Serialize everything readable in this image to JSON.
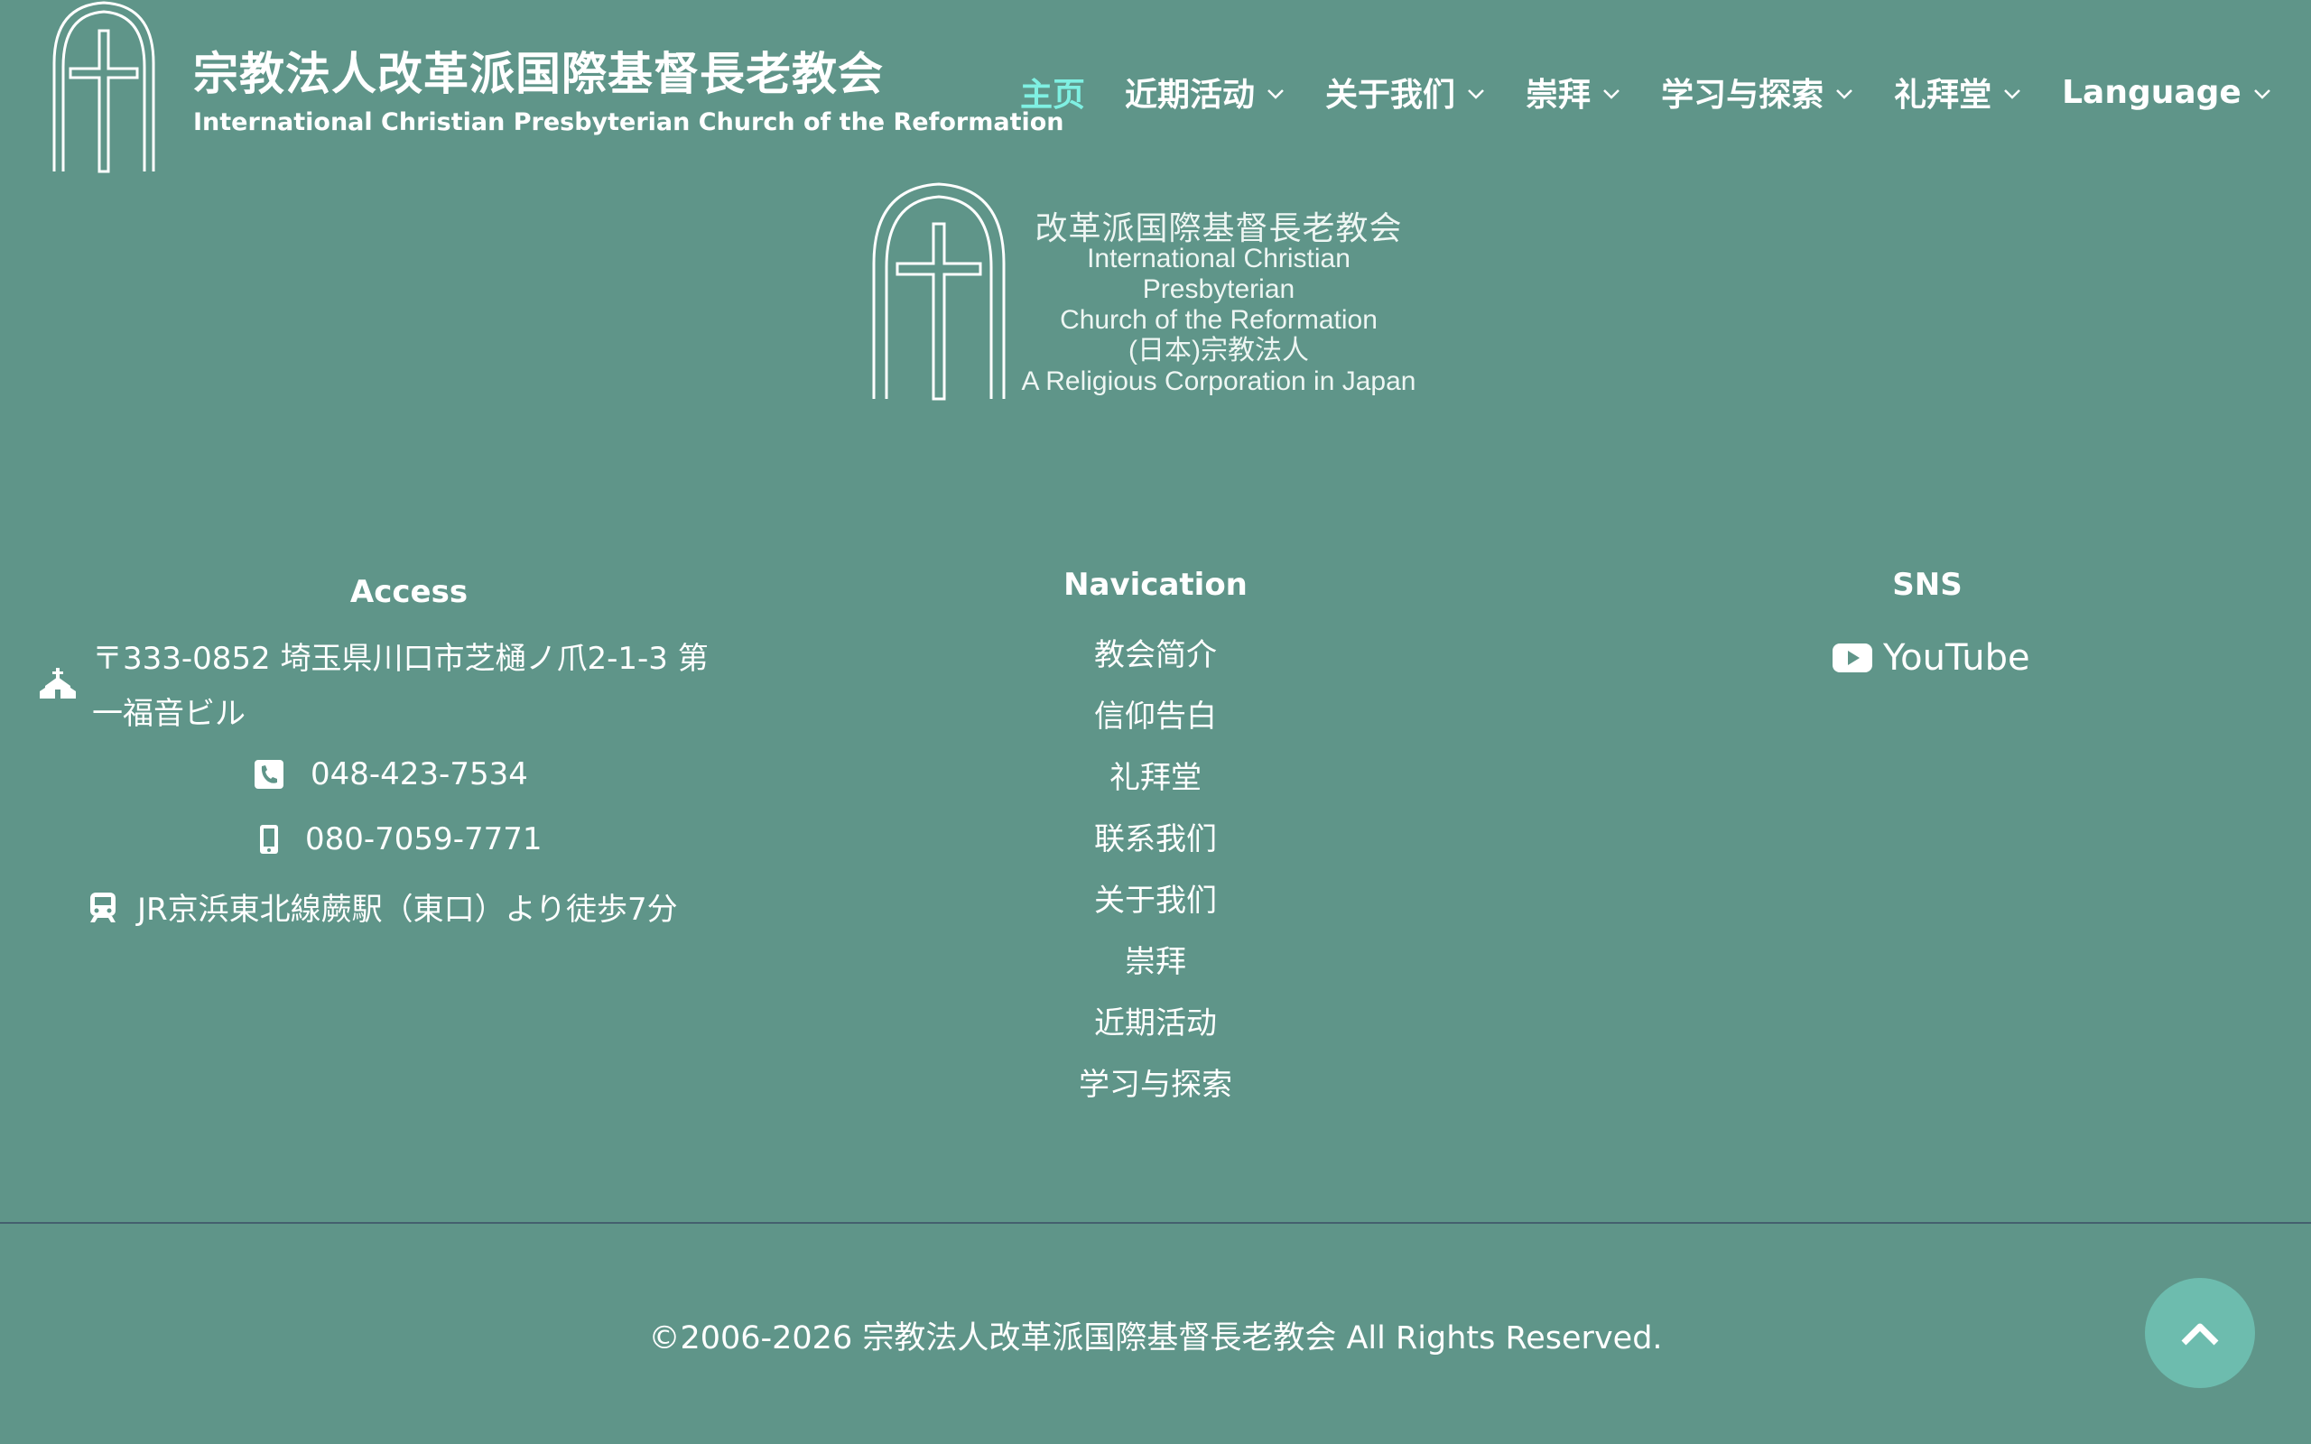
{
  "header": {
    "title": "宗教法人改革派国際基督長老教会",
    "subtitle": "International Christian Presbyterian Church of the Reformation",
    "logo_icon": "church-arch-cross-icon"
  },
  "nav": {
    "items": [
      {
        "label": "主页",
        "active": true,
        "has_dropdown": false
      },
      {
        "label": "近期活动",
        "active": false,
        "has_dropdown": true
      },
      {
        "label": "关于我们",
        "active": false,
        "has_dropdown": true
      },
      {
        "label": "崇拜",
        "active": false,
        "has_dropdown": true
      },
      {
        "label": "学习与探索",
        "active": false,
        "has_dropdown": true
      },
      {
        "label": "礼拜堂",
        "active": false,
        "has_dropdown": true
      },
      {
        "label": "Language",
        "active": false,
        "has_dropdown": true
      }
    ],
    "active_color": "#7ff0e2"
  },
  "center_logo": {
    "line1": "改革派国際基督長老教会",
    "line2": "International Christian Presbyterian",
    "line3": "Church of the Reformation",
    "line4": "(日本)宗教法人",
    "line5": "A Religious Corporation in Japan"
  },
  "access": {
    "heading": "Access",
    "address": "〒333-0852 埼玉県川口市芝樋ノ爪2-1-3 第一福音ビル",
    "tel": "048-423-7534",
    "mobile": "080-7059-7771",
    "train": "JR京浜東北線蕨駅（東口）より徒歩7分",
    "icons": [
      "church-icon",
      "phone-icon",
      "mobile-icon",
      "train-icon"
    ]
  },
  "footer_nav": {
    "heading": "Navication",
    "items": [
      "教会简介",
      "信仰告白",
      "礼拜堂",
      "联系我们",
      "关于我们",
      "崇拜",
      "近期活动",
      "学习与探索"
    ]
  },
  "sns": {
    "heading": "SNS",
    "youtube_label": "YouTube"
  },
  "copyright": "©2006-2026 宗教法人改革派国際基督長老教会 All Rights Reserved.",
  "colors": {
    "background": "#5f9589",
    "to_top_button": "#6dbcae",
    "divider": "#44606e"
  }
}
